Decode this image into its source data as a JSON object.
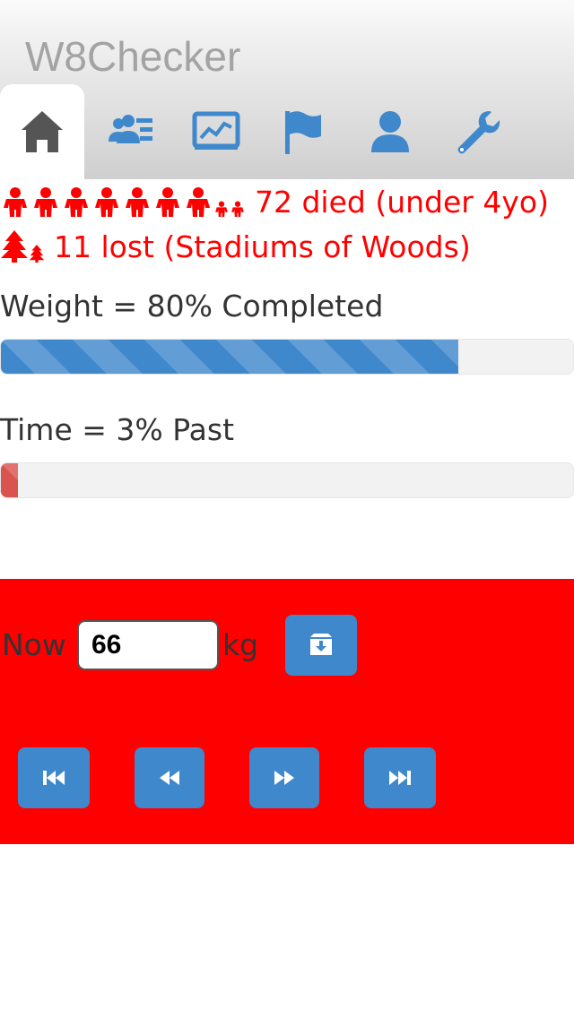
{
  "app": {
    "title": "W8Checker"
  },
  "tabs": [
    {
      "name": "home",
      "icon": "home-icon",
      "active": true
    },
    {
      "name": "people",
      "icon": "user-list-icon",
      "active": false
    },
    {
      "name": "chart",
      "icon": "chart-icon",
      "active": false
    },
    {
      "name": "goal",
      "icon": "flag-icon",
      "active": false
    },
    {
      "name": "profile",
      "icon": "user-icon",
      "active": false
    },
    {
      "name": "settings",
      "icon": "wrench-icon",
      "active": false
    }
  ],
  "stats": {
    "died_text": "72 died (under 4yo)",
    "lost_text": "11 lost (Stadiums of Woods)"
  },
  "progress": {
    "weight_label": "Weight = 80% Completed",
    "weight_fraction": 0.8,
    "time_label": "Time = 3% Past",
    "time_fraction": 0.03
  },
  "entry": {
    "now_label": "Now",
    "weight_value": "66",
    "unit_label": "kg"
  },
  "colors": {
    "accent": "#3f88cc",
    "alert": "#ff0000",
    "time_bar": "#d9534f"
  }
}
